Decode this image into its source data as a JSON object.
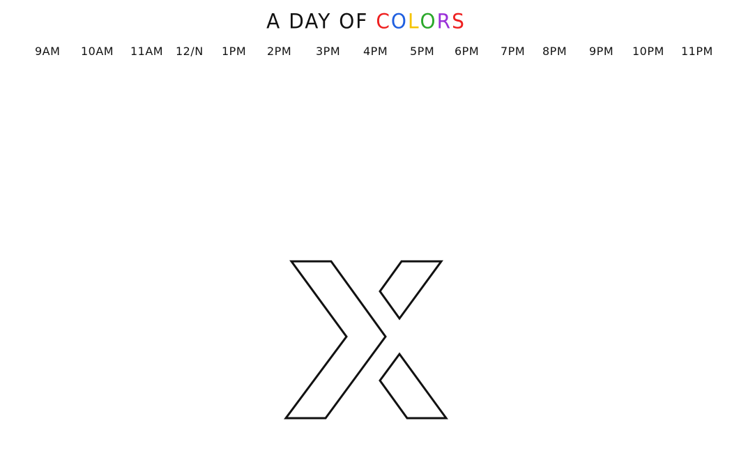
{
  "title": {
    "prefix": "A DAY OF",
    "word_letters": [
      {
        "char": "C",
        "color": "#ee2020"
      },
      {
        "char": "O",
        "color": "#1f5fe0"
      },
      {
        "char": "L",
        "color": "#f5c400"
      },
      {
        "char": "O",
        "color": "#2aa82a"
      },
      {
        "char": "R",
        "color": "#9a2fd8"
      },
      {
        "char": "S",
        "color": "#ee2020"
      }
    ]
  },
  "time_slots": [
    {
      "label": "9AM"
    },
    {
      "label": "10AM"
    },
    {
      "label": "11AM"
    },
    {
      "label": "12/N"
    },
    {
      "label": "1PM"
    },
    {
      "label": "2PM"
    },
    {
      "label": "3PM"
    },
    {
      "label": "4PM"
    },
    {
      "label": "5PM"
    },
    {
      "label": "6PM"
    },
    {
      "label": "7PM"
    },
    {
      "label": "8PM"
    },
    {
      "label": "9PM"
    },
    {
      "label": "10PM"
    },
    {
      "label": "11PM"
    }
  ],
  "logo": {
    "icon": "x-outline-logo-icon",
    "stroke_color": "#111111",
    "fill_color": "#ffffff"
  }
}
